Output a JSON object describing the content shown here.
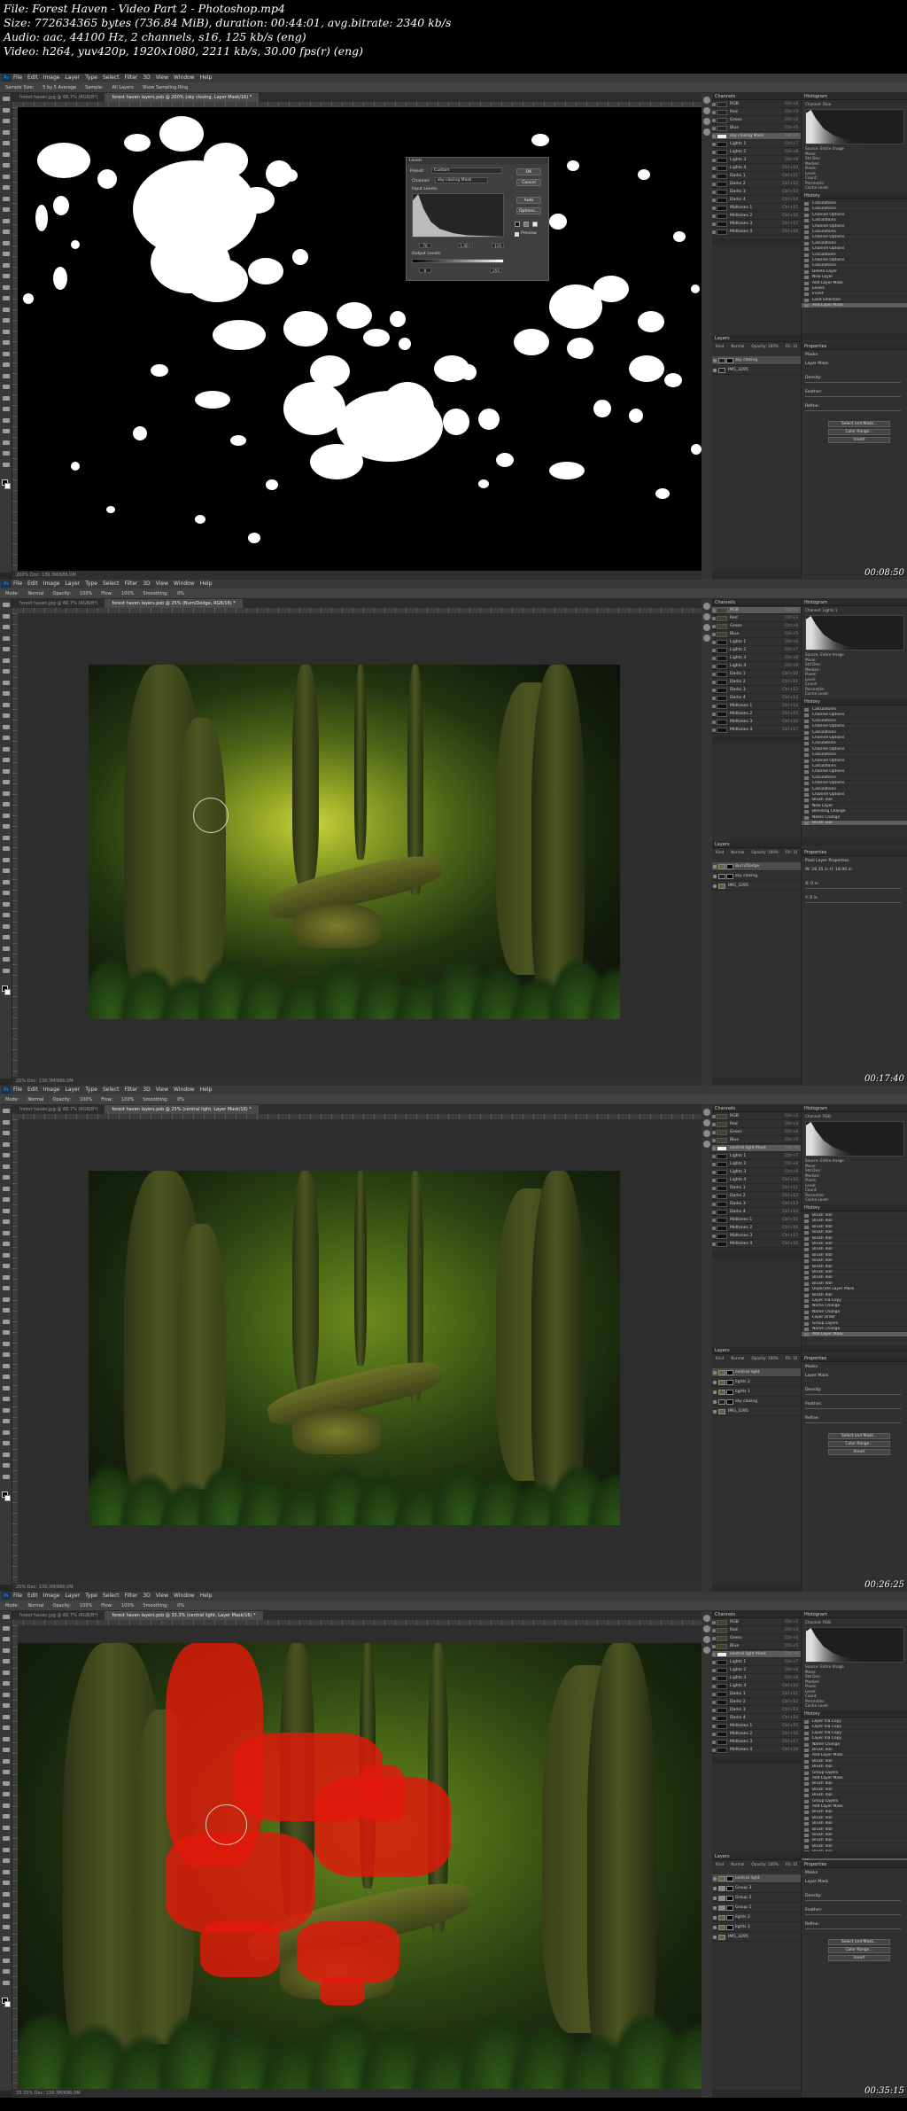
{
  "header": {
    "line1": "File: Forest Haven - Video Part 2 - Photoshop.mp4",
    "line2": "Size: 772634365 bytes (736.84 MiB), duration: 00:44:01, avg.bitrate: 2340 kb/s",
    "line3": "Audio: aac, 44100 Hz, 2 channels, s16, 125 kb/s (eng)",
    "line4": "Video: h264, yuv420p, 1920x1080, 2211 kb/s, 30.00 fps(r) (eng)"
  },
  "menu": [
    "File",
    "Edit",
    "Image",
    "Layer",
    "Type",
    "Select",
    "Filter",
    "3D",
    "View",
    "Window",
    "Help"
  ],
  "app_badge": "Ps",
  "frames": [
    {
      "timestamp": "00:08:50",
      "options": [
        "Sample Size:",
        "5 by 5 Average",
        "Sample:",
        "All Layers",
        "Show Sampling Ring"
      ],
      "tabs": [
        "forest haven.jpg @ 66.7% (RGB/8*)",
        "forest haven layers.psb @ 200% (sky closing, Layer Mask/16) *"
      ],
      "status": "200%   Doc: 139.3M/686.0M",
      "channel_rows": [
        "RGB",
        "Red",
        "Green",
        "Blue",
        "sky closing Mask",
        "Lights 1",
        "Lights 2",
        "Lights 3",
        "Lights 4",
        "Darks 1",
        "Darks 2",
        "Darks 3",
        "Darks 4",
        "Midtones 1",
        "Midtones 2",
        "Midtones 3",
        "Midtones 4"
      ],
      "channel_sel": 4,
      "layers": [
        "sky closing",
        "IMG_3295"
      ],
      "layer_sel": 0,
      "histogram_channel": "Blue",
      "history_rows": [
        "Calculations",
        "Calculations",
        "Channel Options",
        "Calculations",
        "Channel Options",
        "Calculations",
        "Channel Options",
        "Calculations",
        "Channel Options",
        "Calculations",
        "Channel Options",
        "Calculations",
        "Delete Layer",
        "New Layer",
        "Add Layer Mask",
        "Levels",
        "Invert",
        "Load Selection",
        "Add Layer Mask"
      ],
      "history_sel": 18,
      "properties_title": "Masks",
      "properties_sub": "Layer Mask",
      "prop_labels": [
        "Density:",
        "Feather:",
        "Refine:"
      ],
      "prop_buttons": [
        "Select and Mask...",
        "Color Range...",
        "Invert"
      ],
      "dialog": {
        "title": "Levels",
        "preset_label": "Preset:",
        "preset_value": "Custom",
        "channel_label": "Channel:",
        "channel_value": "sky closing Mask",
        "input_label": "Input Levels:",
        "output_label": "Output Levels:",
        "buttons": [
          "OK",
          "Cancel",
          "Auto",
          "Options..."
        ],
        "input_values": [
          "70",
          "1.00",
          "110"
        ],
        "output_values": [
          "0",
          "255"
        ],
        "preview_label": "Preview"
      }
    },
    {
      "timestamp": "00:17:40",
      "options": [
        "Mode:",
        "Normal",
        "Opacity:",
        "100%",
        "Flow:",
        "100%",
        "Smoothing:",
        "0%"
      ],
      "tabs": [
        "forest haven.jpg @ 66.7% (RGB/8*)",
        "forest haven layers.psb @ 25% (Burn/Dodge, RGB/16) *"
      ],
      "status": "25%   Doc: 139.3M/686.0M",
      "channel_rows": [
        "RGB",
        "Red",
        "Green",
        "Blue",
        "Lights 1",
        "Lights 2",
        "Lights 3",
        "Lights 4",
        "Darks 1",
        "Darks 2",
        "Darks 3",
        "Darks 4",
        "Midtones 1",
        "Midtones 2",
        "Midtones 3",
        "Midtones 4"
      ],
      "channel_sel": 0,
      "layers": [
        "Burn/Dodge",
        "sky closing",
        "IMG_3295"
      ],
      "layer_sel": 0,
      "histogram_channel": "Lights 1",
      "history_rows": [
        "Calculations",
        "Channel Options",
        "Calculations",
        "Channel Options",
        "Calculations",
        "Channel Options",
        "Calculations",
        "Channel Options",
        "Calculations",
        "Channel Options",
        "Calculations",
        "Channel Options",
        "Calculations",
        "Channel Options",
        "Calculations",
        "Channel Options",
        "Brush Tool",
        "New Layer",
        "Blending Change",
        "Name Change",
        "Brush Tool"
      ],
      "history_sel": 20,
      "properties_title": "Pixel Layer Properties",
      "properties_sub": "W: 28.35 in   H: 18.90 in",
      "prop_labels": [
        "X: 0 in",
        "Y: 0 in"
      ],
      "prop_buttons": []
    },
    {
      "timestamp": "00:26:25",
      "options": [
        "Mode:",
        "Normal",
        "Opacity:",
        "100%",
        "Flow:",
        "100%",
        "Smoothing:",
        "0%"
      ],
      "tabs": [
        "forest haven.jpg @ 66.7% (RGB/8*)",
        "forest haven layers.psb @ 25% (central light, Layer Mask/16) *"
      ],
      "status": "25%   Doc: 139.3M/686.0M",
      "channel_rows": [
        "RGB",
        "Red",
        "Green",
        "Blue",
        "central light Mask",
        "Lights 1",
        "Lights 2",
        "Lights 3",
        "Lights 4",
        "Darks 1",
        "Darks 2",
        "Darks 3",
        "Darks 4",
        "Midtones 1",
        "Midtones 2",
        "Midtones 3",
        "Midtones 4"
      ],
      "channel_sel": 4,
      "layers": [
        "central light",
        "lights 2",
        "lights 1",
        "sky closing",
        "IMG_3295"
      ],
      "layer_sel": 0,
      "histogram_channel": "RGB",
      "history_rows": [
        "Brush Tool",
        "Brush Tool",
        "Brush Tool",
        "Brush Tool",
        "Brush Tool",
        "Brush Tool",
        "Brush Tool",
        "Brush Tool",
        "Brush Tool",
        "Brush Tool",
        "Brush Tool",
        "Brush Tool",
        "Brush Tool",
        "Duplicate Layer Mask",
        "Brush Tool",
        "Layer Via Copy",
        "Name Change",
        "Name Change",
        "Layer Order",
        "Group Layers",
        "Name Change",
        "Add Layer Mask"
      ],
      "history_sel": 21,
      "properties_title": "Masks",
      "properties_sub": "Layer Mask",
      "prop_labels": [
        "Density:",
        "Feather:",
        "Refine:"
      ],
      "prop_buttons": [
        "Select and Mask...",
        "Color Range...",
        "Invert"
      ]
    },
    {
      "timestamp": "00:35:15",
      "options": [
        "Mode:",
        "Normal",
        "Opacity:",
        "100%",
        "Flow:",
        "100%",
        "Smoothing:",
        "0%"
      ],
      "tabs": [
        "forest haven.jpg @ 66.7% (RGB/8*)",
        "forest haven layers.psb @ 33.3% (central light, Layer Mask/16) *"
      ],
      "status": "33.33%   Doc: 139.3M/686.0M",
      "channel_rows": [
        "RGB",
        "Red",
        "Green",
        "Blue",
        "central light Mask",
        "Lights 1",
        "Lights 2",
        "Lights 3",
        "Lights 4",
        "Darks 1",
        "Darks 2",
        "Darks 3",
        "Darks 4",
        "Midtones 1",
        "Midtones 2",
        "Midtones 3",
        "Midtones 4"
      ],
      "channel_sel": 4,
      "layers": [
        "central light",
        "Group 3",
        "Group 2",
        "Group 1",
        "lights 2",
        "lights 1",
        "IMG_3295"
      ],
      "layer_sel": 0,
      "histogram_channel": "RGB",
      "history_rows": [
        "Layer Via Copy",
        "Layer Via Copy",
        "Layer Via Copy",
        "Layer Via Copy",
        "Name Change",
        "Brush Tool",
        "Add Layer Mask",
        "Brush Tool",
        "Brush Tool",
        "Group Layers",
        "Add Layer Mask",
        "Brush Tool",
        "Brush Tool",
        "Brush Tool",
        "Group Layers",
        "Add Layer Mask",
        "Brush Tool",
        "Brush Tool",
        "Brush Tool",
        "Brush Tool",
        "Brush Tool",
        "Brush Tool",
        "Brush Tool",
        "Brush Tool",
        "Brush Tool"
      ],
      "history_sel": 24,
      "properties_title": "Masks",
      "properties_sub": "Layer Mask",
      "prop_labels": [
        "Density:",
        "Feather:",
        "Refine:"
      ],
      "prop_buttons": [
        "Select and Mask...",
        "Color Range...",
        "Invert"
      ]
    }
  ],
  "panel_titles": {
    "channels": "Channels",
    "histogram": "Histogram",
    "history": "History",
    "layers": "Layers",
    "properties": "Properties"
  },
  "layer_blend": [
    "Kind",
    "Normal",
    "Opacity: 100%",
    "Fill: 100%"
  ],
  "histogram_stats": [
    "Source: Entire Image",
    "Mean:",
    "Std Dev:",
    "Median:",
    "Pixels:",
    "Level:",
    "Count:",
    "Percentile:",
    "Cache Level:"
  ],
  "colors": {
    "accent_red": "#e2190a",
    "ps_blue": "#31a8ff"
  }
}
